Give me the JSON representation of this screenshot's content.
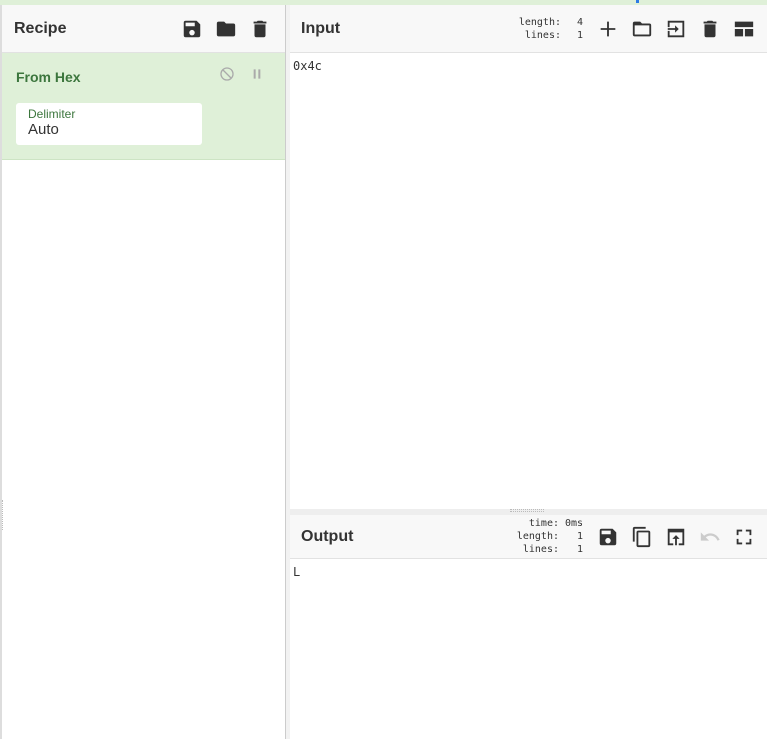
{
  "recipe": {
    "title": "Recipe",
    "icons": [
      "save-icon",
      "folder-icon",
      "trash-icon"
    ],
    "operations": [
      {
        "name": "From Hex",
        "args": [
          {
            "label": "Delimiter",
            "value": "Auto"
          }
        ]
      }
    ]
  },
  "input": {
    "title": "Input",
    "length_label": "length:",
    "length_value": "4",
    "lines_label": "lines:",
    "lines_value": "1",
    "icons": [
      "plus-icon",
      "open-folder-icon",
      "insert-file-icon",
      "trash-icon",
      "layout-icon"
    ],
    "text": "0x4c"
  },
  "output": {
    "title": "Output",
    "time_label": "time:",
    "time_value": "0ms",
    "length_label": "length:",
    "length_value": "1",
    "lines_label": "lines:",
    "lines_value": "1",
    "icons": [
      "save-icon",
      "copy-icon",
      "replace-input-icon",
      "undo-icon",
      "fullscreen-icon"
    ],
    "text": "L"
  },
  "colors": {
    "operation_bg": "#dff0d8",
    "operation_title": "#3c763d",
    "header_bg": "#f8f8f8"
  }
}
